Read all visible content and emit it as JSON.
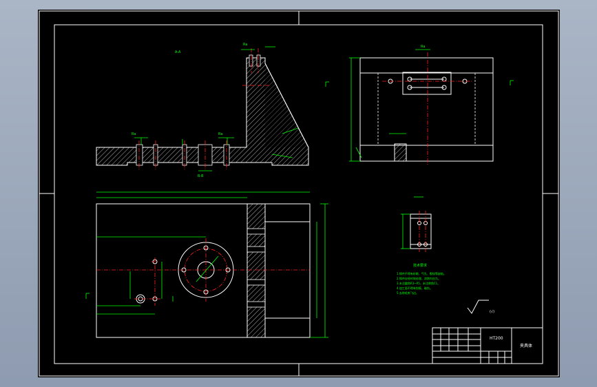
{
  "drawing": {
    "ra_sym": "Ra",
    "tech_title": "技术要求",
    "notes": [
      "1.铸件不得有砂眼、气孔、裂纹等缺陷。",
      "2.铸件应经时效处理，消除内应力。",
      "3.未注圆角R3~R5，未注倒角C1。",
      "4.加工面不得有划痕、碰伤。",
      "5.去除毛刺飞边。"
    ],
    "roughness_label": "(√)",
    "title_block": {
      "material": "HT200",
      "part_name": "夹具体"
    },
    "colors": {
      "background": "#000000",
      "outline": "#ffffff",
      "dimension": "#00ff00",
      "centerline": "#ff2020"
    }
  }
}
